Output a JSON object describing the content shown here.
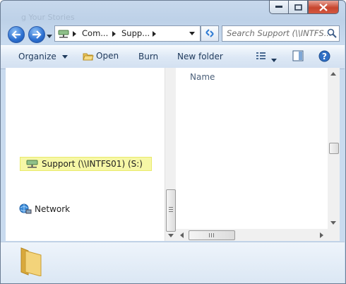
{
  "window": {
    "ghost_title": "g Your Stories",
    "caption": {
      "minimize": "minimize",
      "maximize": "maximize",
      "close": "close"
    }
  },
  "addressbar": {
    "crumbs": [
      "Com...",
      "Supp..."
    ],
    "search_placeholder": "Search Support (\\\\INTFS..."
  },
  "toolbar": {
    "organize": "Organize",
    "open": "Open",
    "burn": "Burn",
    "new_folder": "New folder"
  },
  "navpane": {
    "drive_label": "Support (\\\\INTFS01) (S:)",
    "network_label": "Network"
  },
  "filepane": {
    "column_name": "Name"
  },
  "icons": [
    "back-icon",
    "forward-icon",
    "history-dropdown-icon",
    "network-drive-icon",
    "refresh-icon",
    "search-icon",
    "views-icon",
    "preview-pane-icon",
    "help-icon",
    "network-icon",
    "folder-icon"
  ],
  "colors": {
    "accent": "#1e395b",
    "selection": "#f6f7a6",
    "close_button": "#c7452e"
  }
}
